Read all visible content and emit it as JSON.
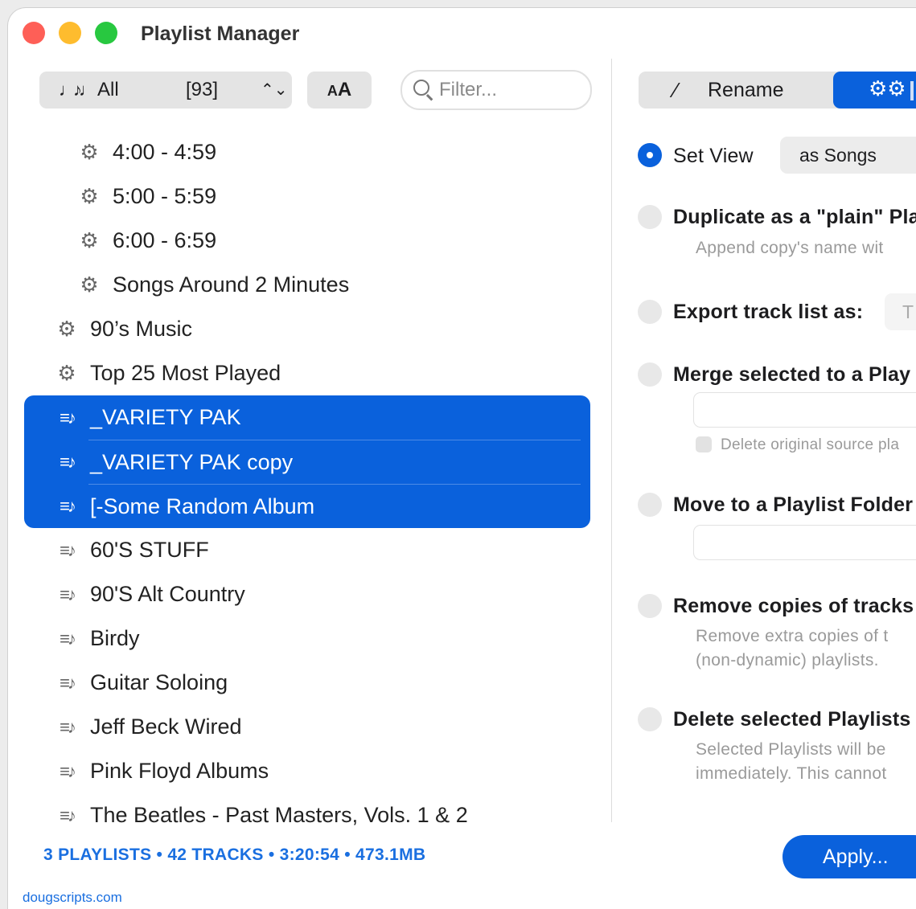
{
  "window": {
    "title": "Playlist Manager"
  },
  "toolbar": {
    "playlist_filter_label": "All",
    "playlist_count": "[93]",
    "font_button_small": "A",
    "font_button_large": "A",
    "filter_placeholder": "Filter..."
  },
  "playlists": {
    "children": [
      {
        "label": "4:00 - 4:59",
        "icon": "smart-playlist-gear-icon"
      },
      {
        "label": "5:00 - 5:59",
        "icon": "smart-playlist-gear-icon"
      },
      {
        "label": "6:00 - 6:59",
        "icon": "smart-playlist-gear-icon"
      },
      {
        "label": "Songs Around 2 Minutes",
        "icon": "smart-playlist-gear-icon"
      }
    ],
    "smart": [
      {
        "label": "90’s Music",
        "icon": "smart-playlist-gear-icon"
      },
      {
        "label": "Top 25 Most Played",
        "icon": "smart-playlist-gear-icon"
      }
    ],
    "selected": [
      {
        "label": "_VARIETY PAK",
        "icon": "playlist-icon"
      },
      {
        "label": "_VARIETY PAK copy",
        "icon": "playlist-icon"
      },
      {
        "label": "[-Some Random Album",
        "icon": "playlist-icon"
      }
    ],
    "regular": [
      {
        "label": "60'S STUFF",
        "icon": "playlist-icon"
      },
      {
        "label": "90'S Alt Country",
        "icon": "playlist-icon"
      },
      {
        "label": "Birdy",
        "icon": "playlist-icon"
      },
      {
        "label": "Guitar Soloing",
        "icon": "playlist-icon"
      },
      {
        "label": "Jeff Beck Wired",
        "icon": "playlist-icon"
      },
      {
        "label": "Pink Floyd Albums",
        "icon": "playlist-icon"
      },
      {
        "label": "The Beatles - Past Masters, Vols. 1 & 2",
        "icon": "playlist-icon"
      }
    ]
  },
  "footer": {
    "stats": "3 PLAYLISTS • 42 TRACKS • 3:20:54 • 473.1MB",
    "site": "dougscripts.com"
  },
  "right_pane": {
    "tabs": {
      "rename_label": "Rename"
    },
    "options": {
      "set_view": {
        "label": "Set View",
        "value": "as Songs",
        "selected": true
      },
      "duplicate": {
        "label": "Duplicate as a \"plain\" Pla",
        "hint": "Append copy's name wit"
      },
      "export": {
        "label": "Export track list as:",
        "value": "T"
      },
      "merge": {
        "label": "Merge selected to a Play",
        "checkbox_label": "Delete original source pla"
      },
      "move": {
        "label": "Move to a Playlist Folder"
      },
      "remove_copies": {
        "label": "Remove copies of tracks",
        "hint_line1": "Remove extra copies of t",
        "hint_line2": "(non-dynamic) playlists."
      },
      "delete": {
        "label": "Delete selected Playlists",
        "hint_line1": "Selected Playlists will be",
        "hint_line2": "immediately. This cannot"
      }
    },
    "apply_label": "Apply..."
  },
  "colors": {
    "accent": "#0a61dc",
    "footer_text": "#1a6fe0"
  }
}
